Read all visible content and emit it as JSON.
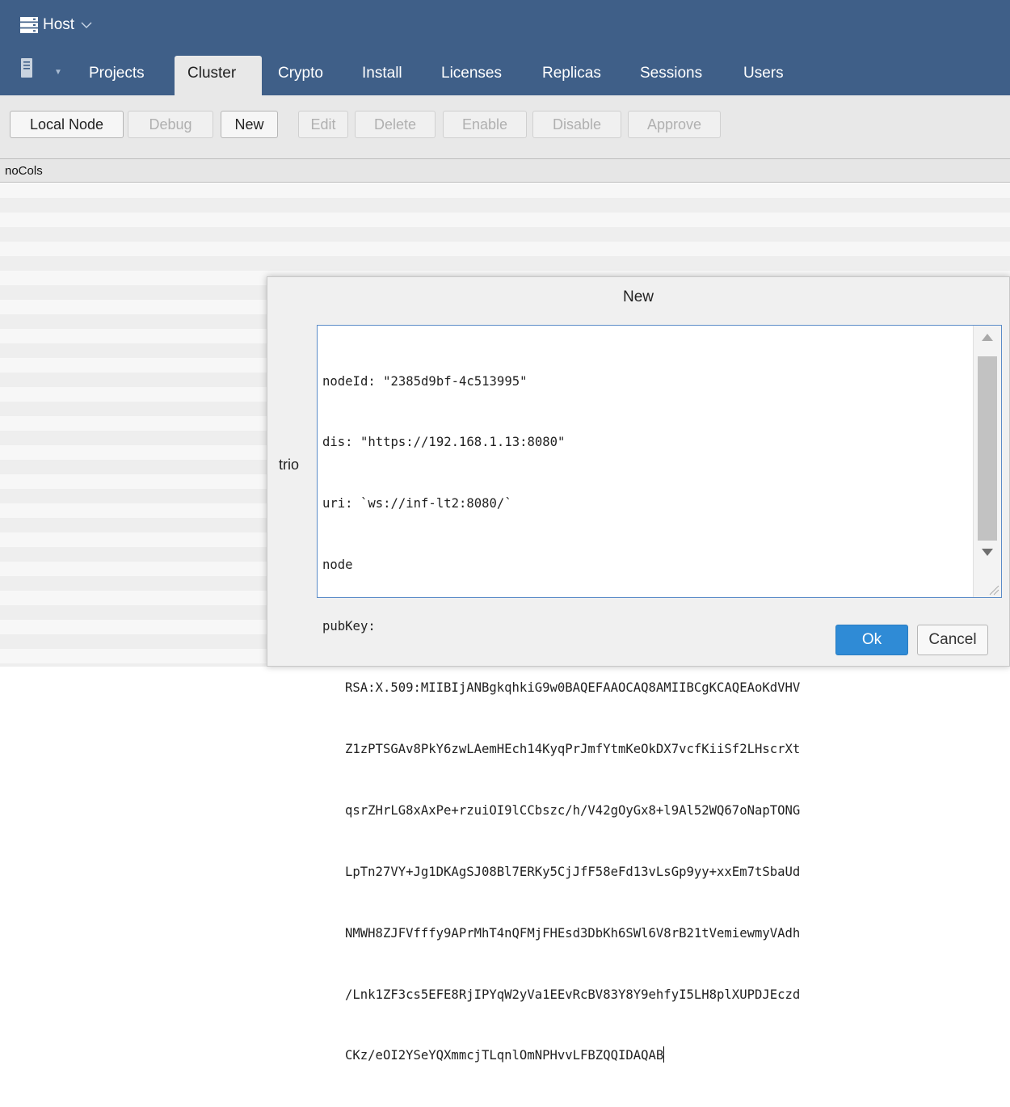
{
  "titlebar": {
    "host_label": "Host",
    "icon": "server-icon",
    "chevron": "chevron-down-icon"
  },
  "tabs": [
    {
      "label": "Projects"
    },
    {
      "label": "Cluster"
    },
    {
      "label": "Crypto"
    },
    {
      "label": "Install"
    },
    {
      "label": "Licenses"
    },
    {
      "label": "Replicas"
    },
    {
      "label": "Sessions"
    },
    {
      "label": "Users"
    }
  ],
  "active_tab": "Cluster",
  "toolbar": {
    "local_node": "Local Node",
    "debug": "Debug",
    "new": "New",
    "edit": "Edit",
    "delete": "Delete",
    "enable": "Enable",
    "disable": "Disable",
    "approve": "Approve"
  },
  "grid": {
    "header": "noCols"
  },
  "dialog": {
    "title": "New",
    "field_label": "trio",
    "lines": [
      "nodeId: \"2385d9bf-4c513995\"",
      "dis: \"https://192.168.1.13:8080\"",
      "uri: `ws://inf-lt2:8080/`",
      "node",
      "pubKey:"
    ],
    "pubkey_lines": [
      "RSA:X.509:MIIBIjANBgkqhkiG9w0BAQEFAAOCAQ8AMIIBCgKCAQEAoKdVHV",
      "Z1zPTSGAv8PkY6zwLAemHEch14KyqPrJmfYtmKeOkDX7vcfKiiSf2LHscrXt",
      "qsrZHrLG8xAxPe+rzuiOI9lCCbszc/h/V42gOyGx8+l9Al52WQ67oNapTONG",
      "LpTn27VY+Jg1DKAgSJ08Bl7ERKy5CjJfF58eFd13vLsGp9yy+xxEm7tSbaUd",
      "NMWH8ZJFVfffy9APrMhT4nQFMjFHEsd3DbKh6SWl6V8rB21tVemiewmyVAdh",
      "/Lnk1ZF3cs5EFE8RjIPYqW2yVa1EEvRcBV83Y8Y9ehfyI5LH8plXUPDJEczd",
      "CKz/eOI2YSeYQXmmcjTLqnlOmNPHvvLFBZQQIDAQAB"
    ],
    "ok": "Ok",
    "cancel": "Cancel"
  },
  "colors": {
    "header": "#3f5f88",
    "accent": "#2f8bd6",
    "focus_border": "#5b8cc8"
  }
}
